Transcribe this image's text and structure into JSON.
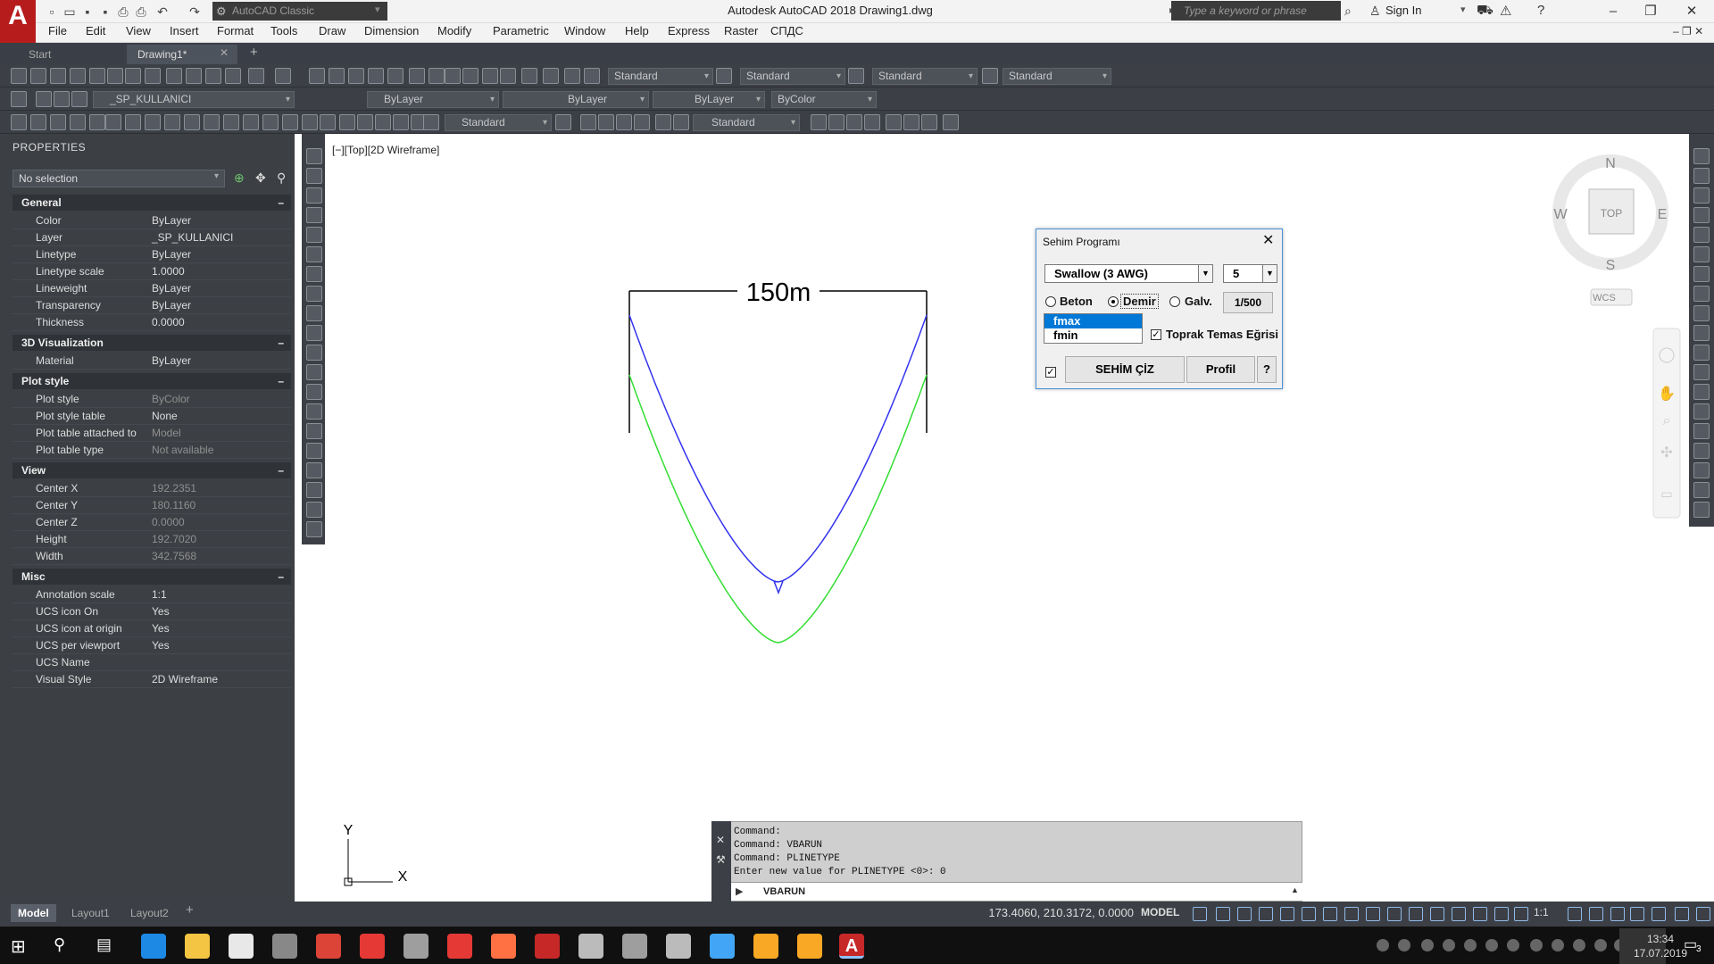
{
  "titlebar": {
    "app_title": "Autodesk AutoCAD 2018    Drawing1.dwg",
    "workspace": "AutoCAD Classic",
    "search_placeholder": "Type a keyword or phrase",
    "sign_in": "Sign In"
  },
  "menu": [
    "File",
    "Edit",
    "View",
    "Insert",
    "Format",
    "Tools",
    "Draw",
    "Dimension",
    "Modify",
    "Parametric",
    "Window",
    "Help",
    "Express",
    "Raster",
    "СПДС"
  ],
  "file_tabs": {
    "start": "Start",
    "drawing": "Drawing1*"
  },
  "toolbar": {
    "text_style": "Standard",
    "dim_style": "Standard",
    "table_style": "Standard",
    "mleader_style": "Standard",
    "layer": "_SP_KULLANICI",
    "color": "ByLayer",
    "linetype": "ByLayer",
    "lineweight": "ByLayer",
    "plotstyle": "ByColor",
    "dim_style2": "Standard",
    "mleader_style2": "Standard"
  },
  "properties": {
    "header": "PROPERTIES",
    "selection": "No selection",
    "sections": {
      "general": {
        "title": "General",
        "rows": [
          {
            "k": "Color",
            "v": "ByLayer"
          },
          {
            "k": "Layer",
            "v": "_SP_KULLANICI"
          },
          {
            "k": "Linetype",
            "v": "ByLayer"
          },
          {
            "k": "Linetype scale",
            "v": "1.0000"
          },
          {
            "k": "Lineweight",
            "v": "ByLayer"
          },
          {
            "k": "Transparency",
            "v": "ByLayer"
          },
          {
            "k": "Thickness",
            "v": "0.0000"
          }
        ]
      },
      "visual3d": {
        "title": "3D Visualization",
        "rows": [
          {
            "k": "Material",
            "v": "ByLayer"
          }
        ]
      },
      "plotstyle": {
        "title": "Plot style",
        "rows": [
          {
            "k": "Plot style",
            "v": "ByColor"
          },
          {
            "k": "Plot style table",
            "v": "None"
          },
          {
            "k": "Plot table attached to",
            "v": "Model"
          },
          {
            "k": "Plot table type",
            "v": "Not available"
          }
        ]
      },
      "view": {
        "title": "View",
        "rows": [
          {
            "k": "Center X",
            "v": "192.2351"
          },
          {
            "k": "Center Y",
            "v": "180.1160"
          },
          {
            "k": "Center Z",
            "v": "0.0000"
          },
          {
            "k": "Height",
            "v": "192.7020"
          },
          {
            "k": "Width",
            "v": "342.7568"
          }
        ]
      },
      "misc": {
        "title": "Misc",
        "rows": [
          {
            "k": "Annotation scale",
            "v": "1:1"
          },
          {
            "k": "UCS icon On",
            "v": "Yes"
          },
          {
            "k": "UCS icon at origin",
            "v": "Yes"
          },
          {
            "k": "UCS per viewport",
            "v": "Yes"
          },
          {
            "k": "UCS Name",
            "v": ""
          },
          {
            "k": "Visual Style",
            "v": "2D Wireframe"
          }
        ]
      }
    }
  },
  "viewport": {
    "label": "[−][Top][2D Wireframe]",
    "dimension_text": "150m",
    "compass": {
      "n": "N",
      "s": "S",
      "e": "E",
      "w": "W",
      "top": "TOP",
      "wcs": "WCS"
    },
    "ucs": {
      "x": "X",
      "y": "Y"
    },
    "curve_colors": {
      "fmax": "#3333ee",
      "fmin": "#33dd33"
    }
  },
  "dialog": {
    "title": "Sehim Programı",
    "conductor": "Swallow (3 AWG)",
    "count": "5",
    "radio": {
      "beton": "Beton",
      "demir": "Demir",
      "galv": "Galv."
    },
    "selected_radio": "demir",
    "scale_button": "1/500",
    "list": [
      "fmax",
      "fmin"
    ],
    "selected_item": "fmax",
    "toprak_label": "Toprak Temas Eğrisi",
    "toprak_checked": true,
    "draw_checked": true,
    "draw_button": "SEHİM ÇİZ",
    "profil_button": "Profil",
    "help_button": "?"
  },
  "command": {
    "history": [
      "Command:",
      "Command: VBARUN",
      "Command: PLINETYPE",
      "Enter new value for PLINETYPE <0>: 0"
    ],
    "input": "VBARUN"
  },
  "status": {
    "layout_tabs": [
      "Model",
      "Layout1",
      "Layout2"
    ],
    "coords": "173.4060, 210.3172, 0.0000",
    "model": "MODEL",
    "scale": "1:1"
  },
  "taskbar": {
    "time": "13:34",
    "date": "17.07.2019",
    "notifications": "3"
  }
}
